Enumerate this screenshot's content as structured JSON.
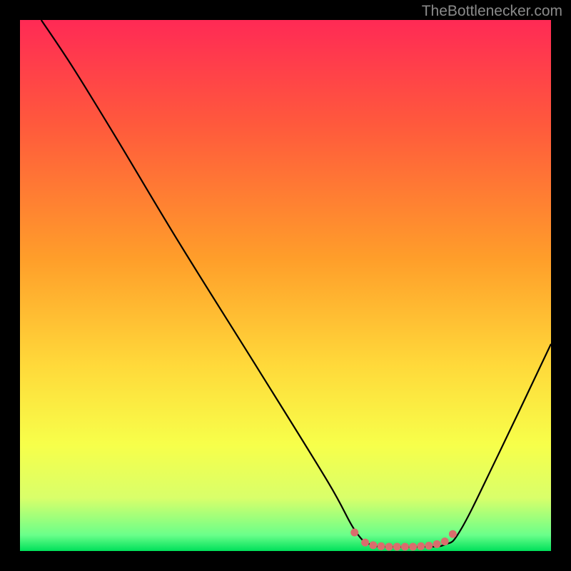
{
  "watermark": "TheBottlenecker.com",
  "chart_data": {
    "type": "line",
    "title": "",
    "xlabel": "",
    "ylabel": "",
    "xlim": [
      0,
      100
    ],
    "ylim": [
      0,
      100
    ],
    "gradient_stops": [
      {
        "offset": 0,
        "color": "#ff2a55"
      },
      {
        "offset": 20,
        "color": "#ff5a3c"
      },
      {
        "offset": 45,
        "color": "#ff9e2a"
      },
      {
        "offset": 65,
        "color": "#ffd93a"
      },
      {
        "offset": 80,
        "color": "#f7ff4a"
      },
      {
        "offset": 90,
        "color": "#d9ff6a"
      },
      {
        "offset": 97,
        "color": "#6aff8a"
      },
      {
        "offset": 100,
        "color": "#00e05a"
      }
    ],
    "series": [
      {
        "name": "bottleneck-curve",
        "color": "#000000",
        "points": [
          {
            "x": 4,
            "y": 100
          },
          {
            "x": 10,
            "y": 91
          },
          {
            "x": 18,
            "y": 78
          },
          {
            "x": 30,
            "y": 58
          },
          {
            "x": 45,
            "y": 34
          },
          {
            "x": 58,
            "y": 13
          },
          {
            "x": 63,
            "y": 4
          },
          {
            "x": 66,
            "y": 1.2
          },
          {
            "x": 70,
            "y": 0.8
          },
          {
            "x": 76,
            "y": 0.8
          },
          {
            "x": 80,
            "y": 1.2
          },
          {
            "x": 83,
            "y": 4
          },
          {
            "x": 90,
            "y": 18
          },
          {
            "x": 100,
            "y": 39
          }
        ]
      },
      {
        "name": "optimal-range-markers",
        "type": "scatter",
        "color": "#d96d6d",
        "points": [
          {
            "x": 63,
            "y": 3.5
          },
          {
            "x": 65,
            "y": 1.6
          },
          {
            "x": 66.5,
            "y": 1.1
          },
          {
            "x": 68,
            "y": 0.9
          },
          {
            "x": 69.5,
            "y": 0.8
          },
          {
            "x": 71,
            "y": 0.8
          },
          {
            "x": 72.5,
            "y": 0.8
          },
          {
            "x": 74,
            "y": 0.8
          },
          {
            "x": 75.5,
            "y": 0.9
          },
          {
            "x": 77,
            "y": 1.0
          },
          {
            "x": 78.5,
            "y": 1.3
          },
          {
            "x": 80,
            "y": 1.8
          },
          {
            "x": 81.5,
            "y": 3.2
          }
        ]
      }
    ]
  }
}
